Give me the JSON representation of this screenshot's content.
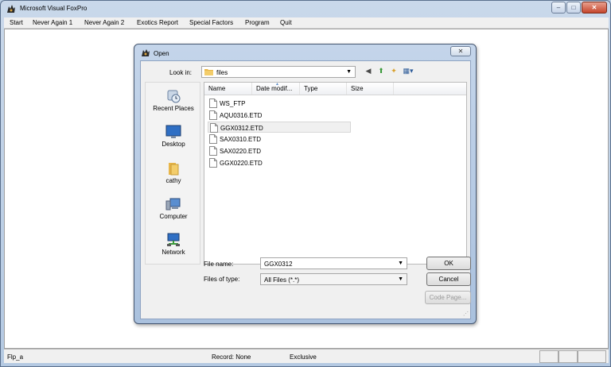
{
  "app": {
    "title": "Microsoft Visual FoxPro",
    "controls": {
      "minimize": "–",
      "maximize": "□",
      "close": "✕"
    }
  },
  "menu": [
    "Start",
    "Never Again 1",
    "Never Again 2",
    "Exotics Report",
    "Special Factors",
    "Program",
    "Quit"
  ],
  "status": {
    "alias": "Flp_a",
    "record": "Record: None",
    "mode": "Exclusive"
  },
  "dialog": {
    "title": "Open",
    "close": "✕",
    "look_in_label": "Look in:",
    "look_in_value": "files",
    "toolbar": {
      "back": "◀",
      "up": "⬆",
      "new_folder": "✦",
      "views": "▦▾"
    },
    "places": [
      "Recent Places",
      "Desktop",
      "cathy",
      "Computer",
      "Network"
    ],
    "columns": [
      "Name",
      "Date modif...",
      "Type",
      "Size"
    ],
    "files": [
      {
        "name": "WS_FTP",
        "kind": "folder"
      },
      {
        "name": "AQU0316.ETD",
        "kind": "file"
      },
      {
        "name": "GGX0312.ETD",
        "kind": "file",
        "selected": true
      },
      {
        "name": "SAX0310.ETD",
        "kind": "file"
      },
      {
        "name": "SAX0220.ETD",
        "kind": "file"
      },
      {
        "name": "GGX0220.ETD",
        "kind": "file"
      }
    ],
    "file_name_label": "File name:",
    "file_name_value": "GGX0312",
    "file_type_label": "Files of type:",
    "file_type_value": "All Files (*.*)",
    "ok": "OK",
    "cancel": "Cancel",
    "code_page": "Code Page..."
  },
  "colors": {
    "accent": "#5b8cc5",
    "window_frame": "#b4c9e2",
    "folder": "#e8b64a"
  }
}
